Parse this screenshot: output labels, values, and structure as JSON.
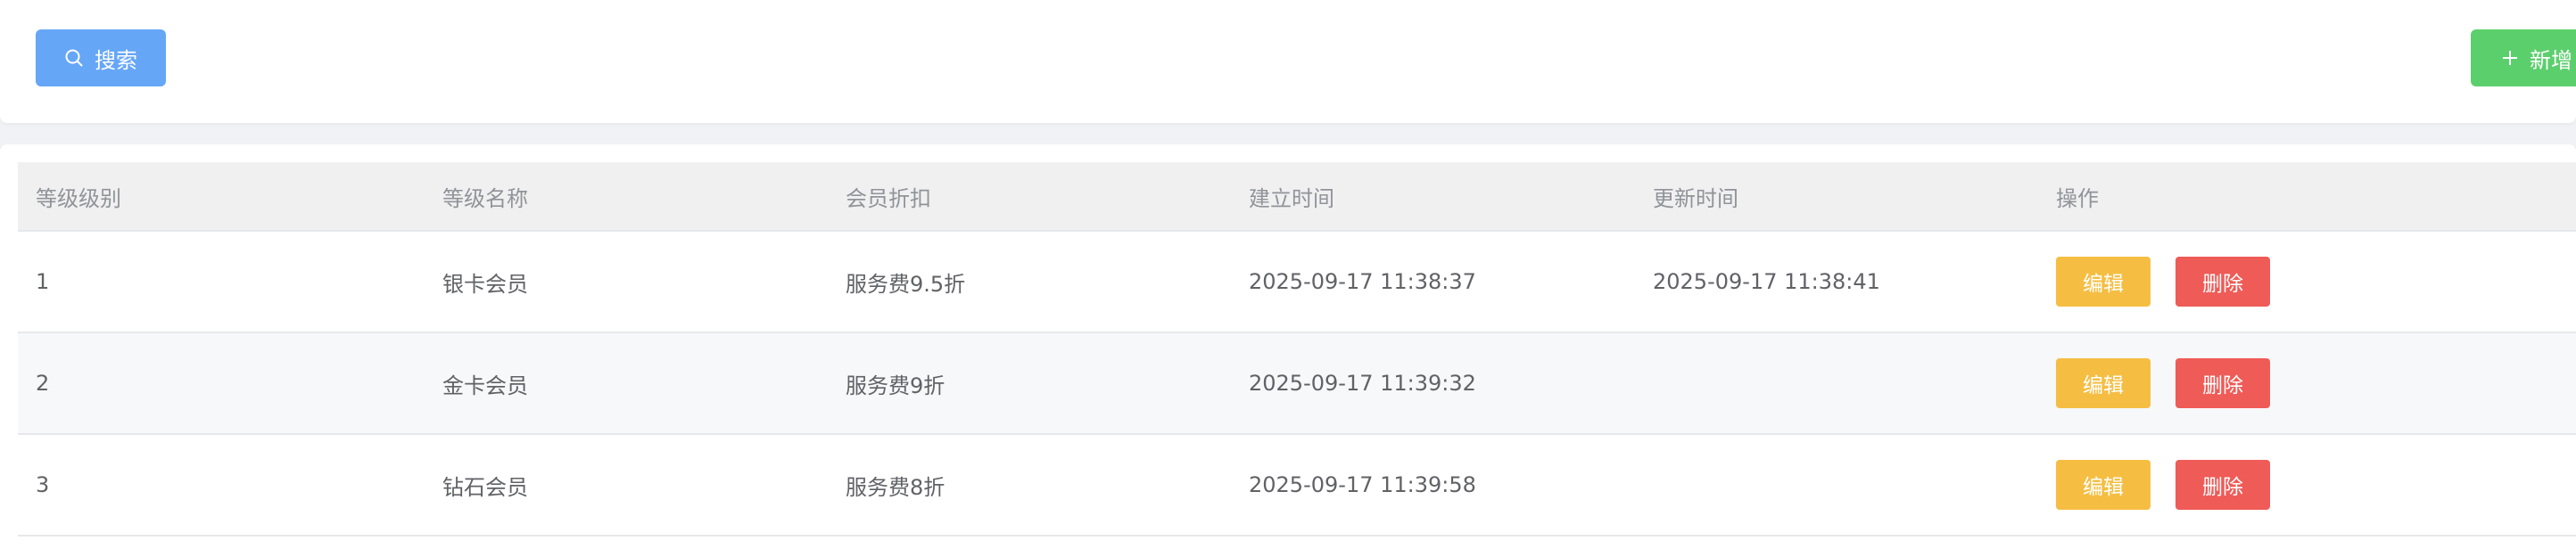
{
  "toolbar": {
    "search_label": "搜索",
    "add_label": "新增"
  },
  "table": {
    "headers": [
      "等级级别",
      "等级名称",
      "会员折扣",
      "建立时间",
      "更新时间",
      "操作"
    ],
    "rows": [
      {
        "level": "1",
        "name": "银卡会员",
        "discount": "服务费9.5折",
        "created": "2025-09-17 11:38:37",
        "updated": "2025-09-17 11:38:41"
      },
      {
        "level": "2",
        "name": "金卡会员",
        "discount": "服务费9折",
        "created": "2025-09-17 11:39:32",
        "updated": ""
      },
      {
        "level": "3",
        "name": "钻石会员",
        "discount": "服务费8折",
        "created": "2025-09-17 11:39:58",
        "updated": ""
      }
    ],
    "edit_label": "编辑",
    "delete_label": "删除"
  },
  "colors": {
    "primary": "#66a6f7",
    "success": "#5ccf6d",
    "warning": "#f5be43",
    "danger": "#ef5b57"
  },
  "icons": {
    "search": "search-icon",
    "add": "plus-icon"
  }
}
